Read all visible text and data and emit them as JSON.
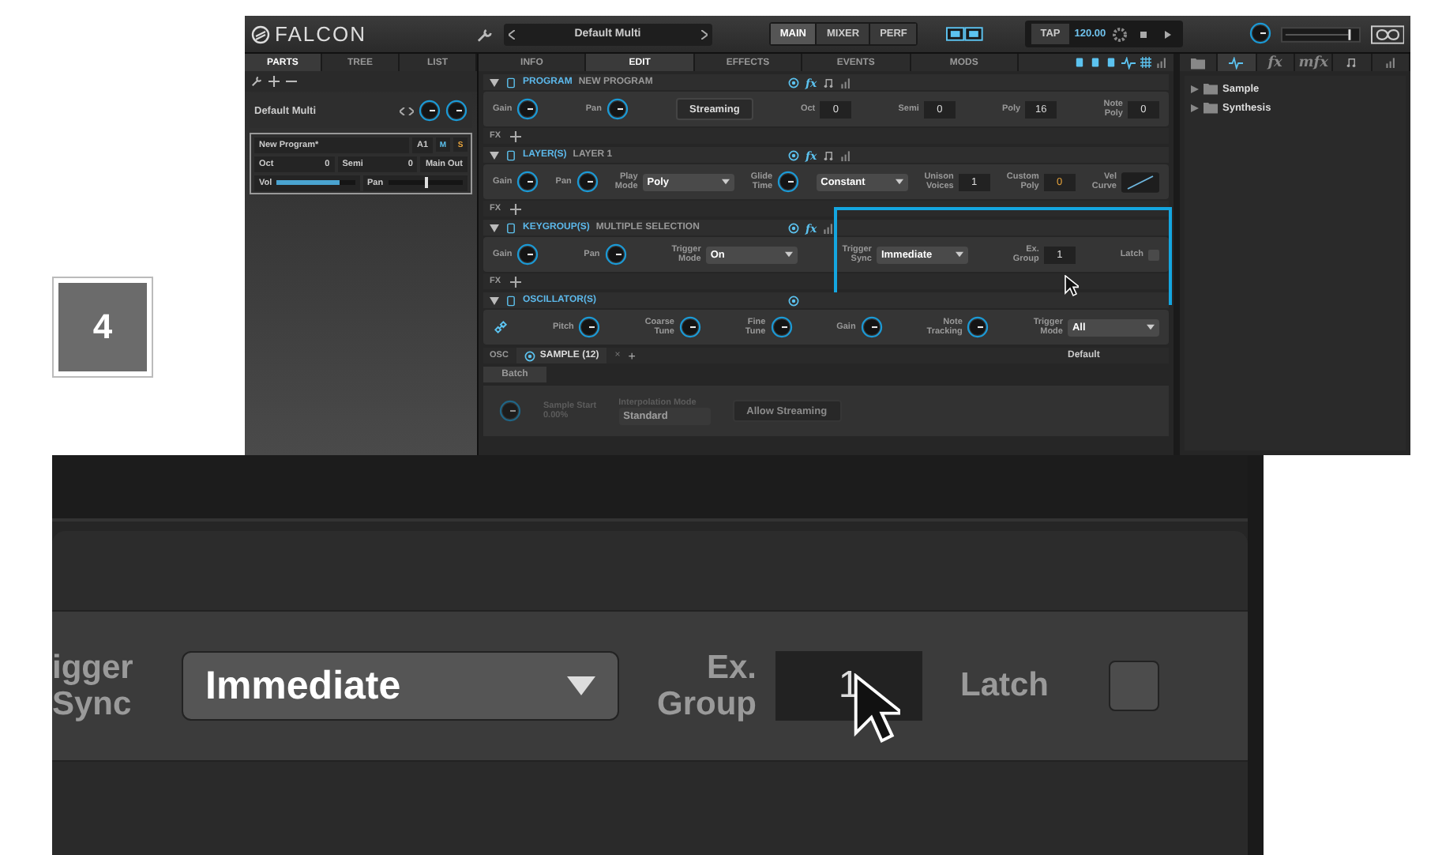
{
  "step_badge": "4",
  "app": {
    "logo": "FALCON",
    "toolbar": {
      "multi_name": "Default Multi",
      "views": [
        {
          "label": "MAIN",
          "selected": true
        },
        {
          "label": "MIXER",
          "selected": false
        },
        {
          "label": "PERF",
          "selected": false
        }
      ],
      "tap": "TAP",
      "tempo": "120.00"
    },
    "left_tabs": [
      {
        "label": "PARTS",
        "selected": true
      },
      {
        "label": "TREE",
        "selected": false
      },
      {
        "label": "LIST",
        "selected": false
      }
    ],
    "multi": {
      "name": "Default Multi"
    },
    "program": {
      "name": "New Program*",
      "slot": "A1",
      "mute": "M",
      "solo": "S",
      "oct_label": "Oct",
      "oct": "0",
      "semi_label": "Semi",
      "semi": "0",
      "output": "Main Out",
      "vol_label": "Vol",
      "vol": {
        "level": 0.8
      },
      "pan_label": "Pan",
      "pan": {
        "level": 0.5
      }
    },
    "editor_tabs": [
      {
        "label": "INFO",
        "selected": false
      },
      {
        "label": "EDIT",
        "selected": true
      },
      {
        "label": "EFFECTS",
        "selected": false
      },
      {
        "label": "EVENTS",
        "selected": false
      },
      {
        "label": "MODS",
        "selected": false
      }
    ],
    "sections": [
      {
        "title": "PROGRAM",
        "subtitle": "NEW PROGRAM",
        "header_icons": [
          {
            "kind": "power"
          },
          {
            "kind": "fx",
            "label": "fx"
          },
          {
            "kind": "note"
          },
          {
            "kind": "bars"
          }
        ],
        "controls": [
          {
            "kind": "knob",
            "label": "Gain"
          },
          {
            "kind": "knob",
            "label": "Pan"
          },
          {
            "kind": "button",
            "value": "Streaming"
          },
          {
            "kind": "field",
            "label": "Oct",
            "value": "0",
            "modified": false
          },
          {
            "kind": "field",
            "label": "Semi",
            "value": "0",
            "modified": false
          },
          {
            "kind": "field",
            "label": "Poly",
            "value": "16",
            "modified": false
          },
          {
            "kind": "field",
            "label": "Note Poly",
            "value": "0",
            "modified": false
          }
        ],
        "fx_label": "FX",
        "highlighted": false
      },
      {
        "title": "LAYER(S)",
        "subtitle": "LAYER 1",
        "header_icons": [
          {
            "kind": "power"
          },
          {
            "kind": "fx",
            "label": "fx"
          },
          {
            "kind": "note"
          },
          {
            "kind": "bars"
          }
        ],
        "controls": [
          {
            "kind": "knob",
            "label": "Gain"
          },
          {
            "kind": "knob",
            "label": "Pan"
          },
          {
            "kind": "dropdown",
            "label": "Play Mode",
            "value": "Poly"
          },
          {
            "kind": "knob",
            "label": "Glide Time"
          },
          {
            "kind": "dropdown",
            "value": "Constant"
          },
          {
            "kind": "field",
            "label": "Unison Voices",
            "value": "1",
            "modified": false
          },
          {
            "kind": "field",
            "label": "Custom Poly",
            "value": "0",
            "modified": true
          },
          {
            "kind": "curve",
            "label": "Vel Curve"
          }
        ],
        "fx_label": "FX",
        "highlighted": false
      },
      {
        "title": "KEYGROUP(S)",
        "subtitle": "MULTIPLE SELECTION",
        "header_icons": [
          {
            "kind": "power"
          },
          {
            "kind": "fx",
            "label": "fx"
          },
          {
            "kind": "bars"
          }
        ],
        "controls": [
          {
            "kind": "knob",
            "label": "Gain"
          },
          {
            "kind": "knob",
            "label": "Pan"
          },
          {
            "kind": "dropdown",
            "label": "Trigger Mode",
            "value": "On"
          },
          {
            "kind": "dropdown",
            "label": "Trigger Sync",
            "value": "Immediate"
          },
          {
            "kind": "field",
            "label": "Ex. Group",
            "value": "1",
            "modified": false
          },
          {
            "kind": "checkbox",
            "label": "Latch",
            "checked": false
          }
        ],
        "fx_label": "FX",
        "highlighted": true
      },
      {
        "title": "OSCILLATOR(S)",
        "header_icons": [
          {
            "kind": "power"
          }
        ],
        "controls": [
          {
            "kind": "link"
          },
          {
            "kind": "knob",
            "label": "Pitch"
          },
          {
            "kind": "knob",
            "label": "Coarse Tune"
          },
          {
            "kind": "knob",
            "label": "Fine Tune"
          },
          {
            "kind": "knob",
            "label": "Gain"
          },
          {
            "kind": "knob",
            "label": "Note Tracking"
          },
          {
            "kind": "dropdown",
            "label": "Trigger Mode",
            "value": "All"
          }
        ],
        "highlighted": false
      }
    ],
    "osc_bar": {
      "label": "OSC",
      "tab": "SAMPLE (12)",
      "close": "×",
      "add": "+",
      "preset": "Default"
    },
    "batch": "Batch",
    "sample_controls": [
      {
        "kind": "readout",
        "label": "Sample Start",
        "value": "0.00%"
      },
      {
        "kind": "dropdown_top",
        "label": "Interpolation Mode",
        "value": "Standard"
      },
      {
        "kind": "button",
        "value": "Allow Streaming"
      }
    ],
    "browser_tabs": [
      {
        "kind": "folder",
        "selected": false
      },
      {
        "kind": "wave",
        "selected": true
      },
      {
        "kind": "text",
        "label": "fx",
        "selected": false
      },
      {
        "kind": "text",
        "label": "mfx",
        "selected": false
      },
      {
        "kind": "note",
        "selected": false
      },
      {
        "kind": "bars",
        "selected": false
      }
    ],
    "browser_items": [
      {
        "label": "Sample",
        "expanded": false
      },
      {
        "label": "Synthesis",
        "expanded": false
      }
    ]
  },
  "zoom": {
    "sync_label": "igger Sync",
    "sync_value": "Immediate",
    "group_label": "Ex. Group",
    "group_value": "1",
    "latch_label": "Latch",
    "latch_checked": false
  }
}
